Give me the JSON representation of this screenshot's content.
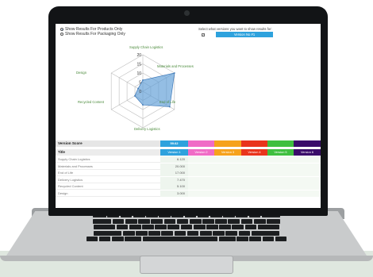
{
  "filters": {
    "products_label": "Show Results For Products Only",
    "packaging_label": "Show Results For Packaging Only",
    "selected": "products"
  },
  "version_selector": {
    "prompt": "Select what versions you want to show results for:",
    "checked": true,
    "button_label": "Version No #1"
  },
  "chart_data": {
    "type": "radar",
    "categories": [
      "Supply Chain Logistics",
      "Materials and Processes",
      "End of Life",
      "Delivery Logistics",
      "Recycled Content",
      "Design"
    ],
    "axis_ticks": [
      "20",
      "15",
      "10",
      "5",
      "0"
    ],
    "rlim": [
      0,
      20
    ],
    "series": [
      {
        "values": [
          6.12,
          20,
          17,
          7.47,
          5.1,
          3
        ]
      }
    ]
  },
  "radar_labels": {
    "supply_chain": "Supply Chain Logistics",
    "materials": "Materials and Processes",
    "end_of_life": "End of Life",
    "delivery": "Delivery Logistics",
    "recycled": "Recycled Content",
    "design": "Design"
  },
  "table": {
    "version_score_label": "Version Score",
    "score_value": "59.62",
    "title_header": "Title",
    "versions": [
      {
        "label": "Version 1",
        "color": "#2ea2dd"
      },
      {
        "label": "Version 2",
        "color": "#f06cc6"
      },
      {
        "label": "Version 3",
        "color": "#f6a21c"
      },
      {
        "label": "Version 4",
        "color": "#e9341c"
      },
      {
        "label": "Version 5",
        "color": "#3fbf3f"
      },
      {
        "label": "Version 6",
        "color": "#3a0c6a"
      }
    ],
    "rows": [
      {
        "name": "Supply Chain Logistics",
        "v1": "6.120"
      },
      {
        "name": "Materials and Processes",
        "v1": "20.000"
      },
      {
        "name": "End of Life",
        "v1": "17.000"
      },
      {
        "name": "Delivery Logistics",
        "v1": "7.470"
      },
      {
        "name": "Recycled Content",
        "v1": "5.100"
      },
      {
        "name": "Design",
        "v1": "3.000"
      }
    ]
  },
  "colors": {
    "accent": "#2ea2dd",
    "radar_fill": "#5b9bd5",
    "label_green": "#4a8a3a"
  }
}
